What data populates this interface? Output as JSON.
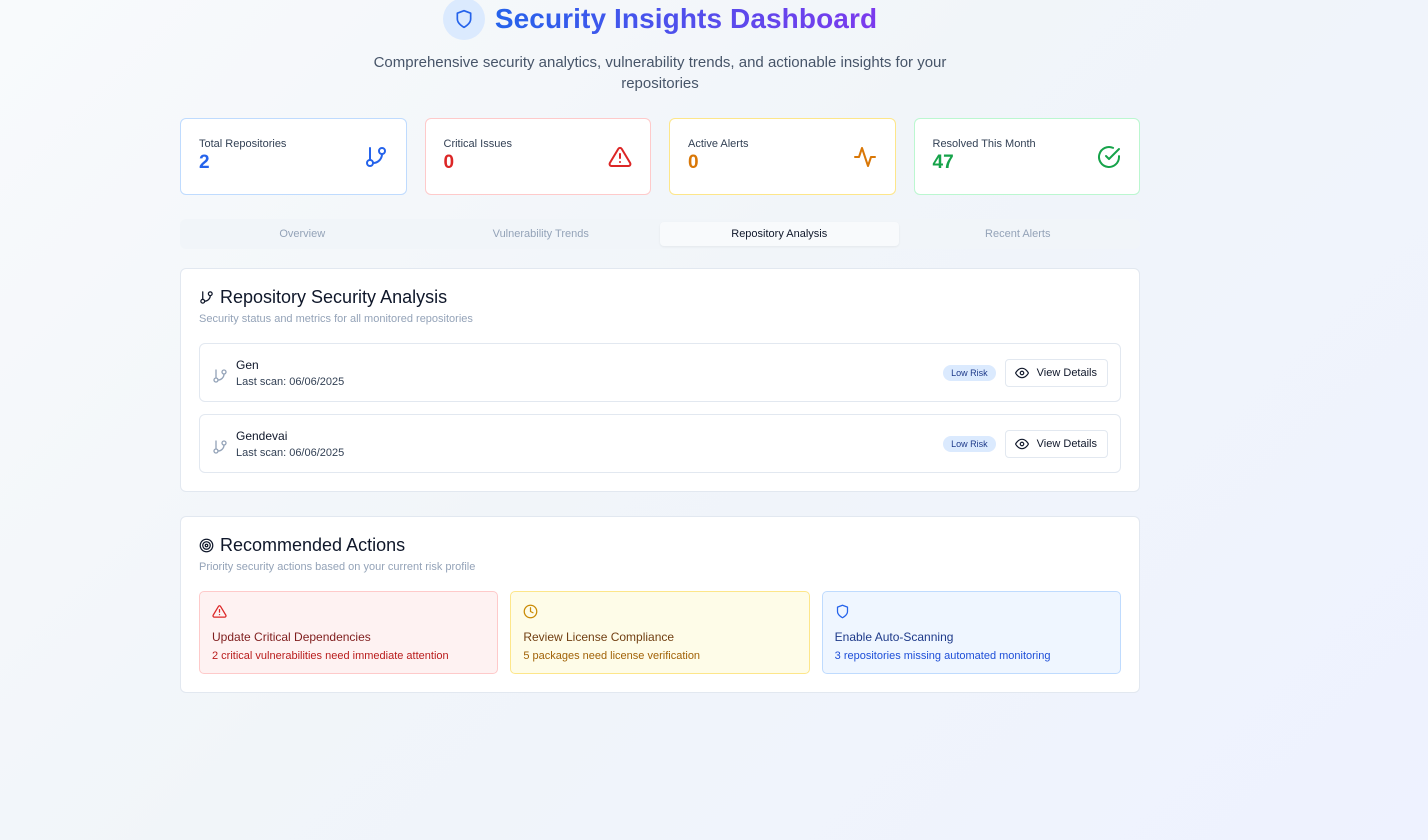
{
  "header": {
    "title": "Security Insights Dashboard",
    "subtitle": "Comprehensive security analytics, vulnerability trends, and actionable insights for your repositories"
  },
  "stats": [
    {
      "label": "Total Repositories",
      "value": "2",
      "color": "#2563eb",
      "icon": "git-branch-icon"
    },
    {
      "label": "Critical Issues",
      "value": "0",
      "color": "#dc2626",
      "icon": "alert-triangle-icon"
    },
    {
      "label": "Active Alerts",
      "value": "0",
      "color": "#d97706",
      "icon": "activity-icon"
    },
    {
      "label": "Resolved This Month",
      "value": "47",
      "color": "#16a34a",
      "icon": "check-circle-icon"
    }
  ],
  "tabs": [
    {
      "label": "Overview",
      "active": false
    },
    {
      "label": "Vulnerability Trends",
      "active": false
    },
    {
      "label": "Repository Analysis",
      "active": true
    },
    {
      "label": "Recent Alerts",
      "active": false
    }
  ],
  "repo_analysis": {
    "title": "Repository Security Analysis",
    "description": "Security status and metrics for all monitored repositories",
    "repos": [
      {
        "name": "Gen",
        "last_scan": "Last scan: 06/06/2025",
        "risk": "Low Risk",
        "button": "View Details"
      },
      {
        "name": "Gendevai",
        "last_scan": "Last scan: 06/06/2025",
        "risk": "Low Risk",
        "button": "View Details"
      }
    ]
  },
  "recommended": {
    "title": "Recommended Actions",
    "description": "Priority security actions based on your current risk profile",
    "actions": [
      {
        "title": "Update Critical Dependencies",
        "desc": "2 critical vulnerabilities need immediate attention",
        "icon": "alert-triangle-icon"
      },
      {
        "title": "Review License Compliance",
        "desc": "5 packages need license verification",
        "icon": "clock-icon"
      },
      {
        "title": "Enable Auto-Scanning",
        "desc": "3 repositories missing automated monitoring",
        "icon": "shield-icon"
      }
    ]
  },
  "colors": {
    "accent_blue": "#2563eb",
    "accent_purple": "#7c3aed",
    "critical_red": "#dc2626",
    "alert_amber": "#d97706",
    "resolved_green": "#16a34a"
  }
}
